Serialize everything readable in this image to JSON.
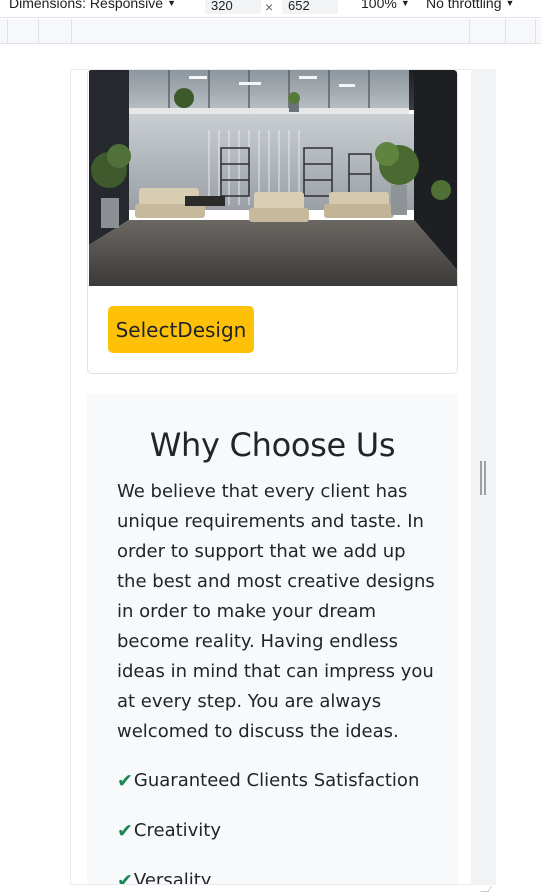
{
  "devtools": {
    "dimensions_label": "Dimensions: Responsive",
    "width_value": "320",
    "height_value": "652",
    "times": "×",
    "zoom_label": "100%",
    "throttle_label": "No throttling",
    "caret": "▼"
  },
  "card": {
    "image_alt": "Modern office lounge interior with beige sofas and potted plants",
    "button_label": "SelectDesign"
  },
  "why": {
    "title": "Why Choose Us",
    "body": "We believe that every client has unique requirements and taste. In order to support that we add up the best and most creative designs in order to make your dream become reality. Having endless ideas in mind that can impress you at every step. You are always welcomed to discuss the ideas.",
    "check_icon": "✔",
    "features": [
      "Guaranteed Clients Satisfaction",
      "Creativity",
      "Versality"
    ]
  },
  "colors": {
    "button": "#ffc107",
    "section_bg": "#f8f9fa",
    "check": "#198754",
    "text": "#212529"
  }
}
